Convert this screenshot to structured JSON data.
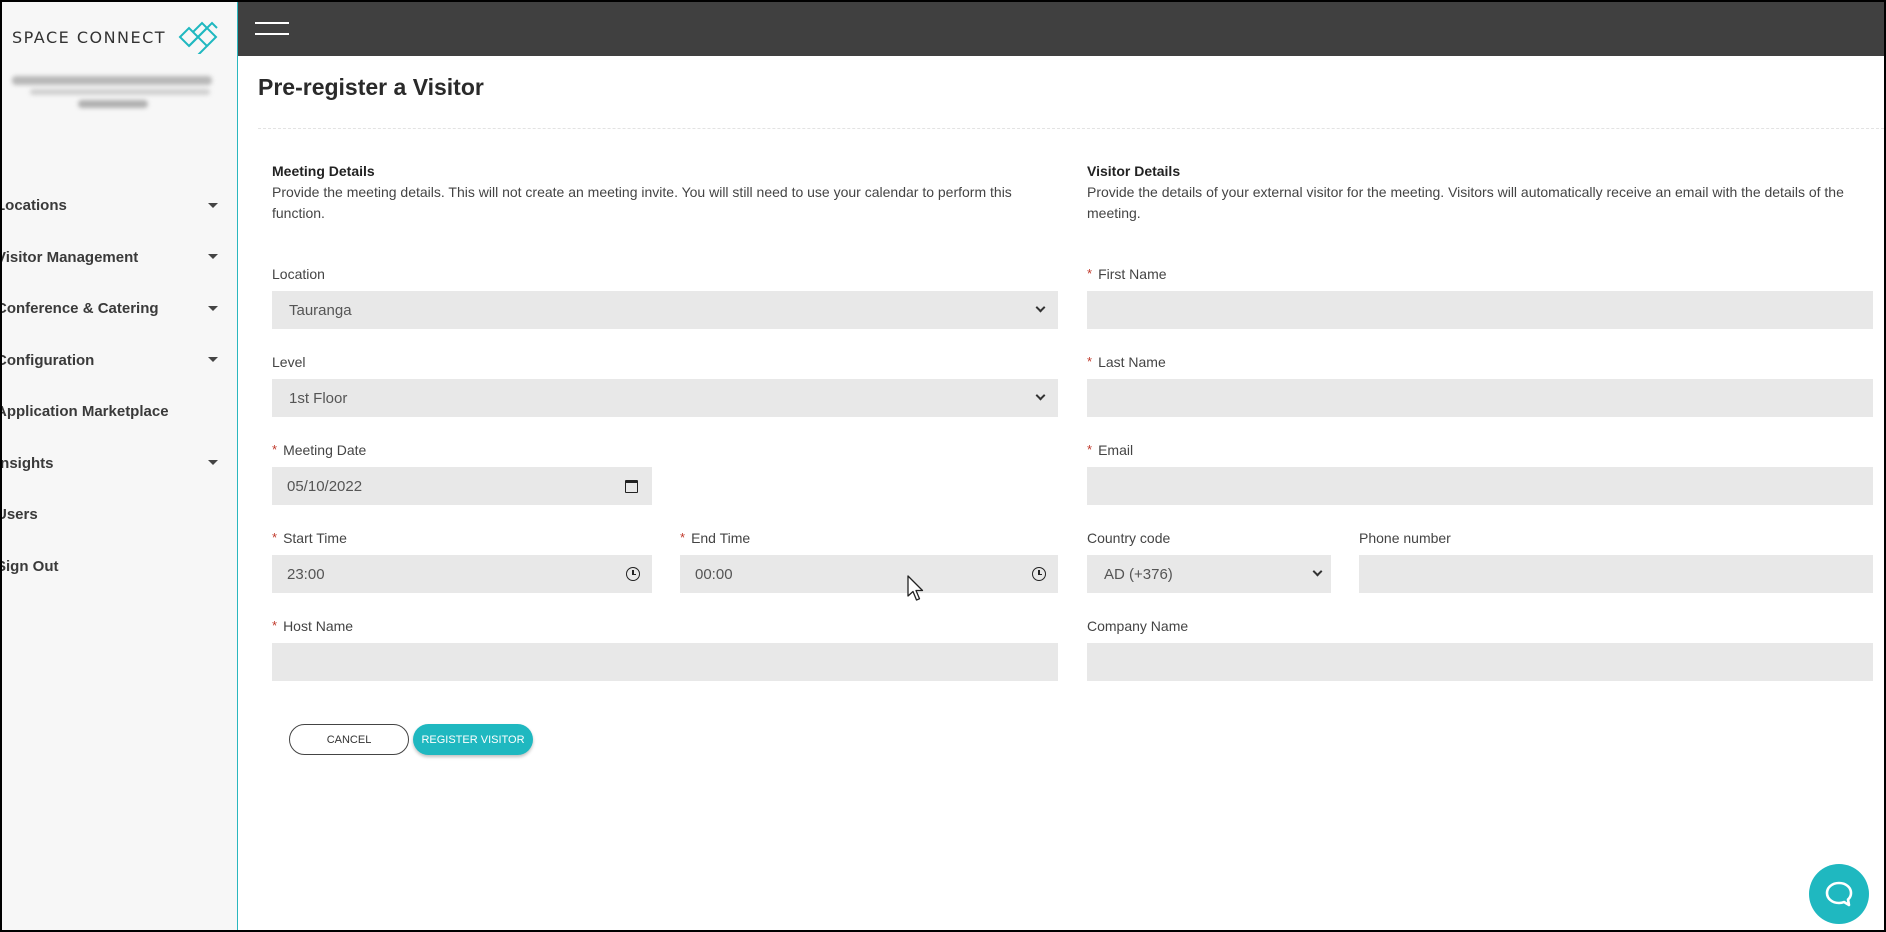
{
  "brand": {
    "logo_text": "SPACE CONNECT",
    "accent": "#1fb8c0"
  },
  "sidebar": {
    "items": [
      {
        "label": "Locations",
        "has_caret": true
      },
      {
        "label": "Visitor Management",
        "has_caret": true
      },
      {
        "label": "Conference & Catering",
        "has_caret": true
      },
      {
        "label": "Configuration",
        "has_caret": true
      },
      {
        "label": "Application Marketplace",
        "has_caret": false
      },
      {
        "label": "Insights",
        "has_caret": true
      },
      {
        "label": "Users",
        "has_caret": false
      },
      {
        "label": "Sign Out",
        "has_caret": false
      }
    ]
  },
  "page": {
    "title": "Pre-register a Visitor"
  },
  "meeting": {
    "heading": "Meeting Details",
    "description": "Provide the meeting details. This will not create an meeting invite. You will still need to use your calendar to perform this function.",
    "location": {
      "label": "Location",
      "value": "Tauranga"
    },
    "level": {
      "label": "Level",
      "value": "1st Floor"
    },
    "date": {
      "label": "Meeting Date",
      "value": "05/10/2022"
    },
    "start": {
      "label": "Start Time",
      "value": "23:00"
    },
    "end": {
      "label": "End Time",
      "value": "00:00"
    },
    "host": {
      "label": "Host Name",
      "value": ""
    }
  },
  "visitor": {
    "heading": "Visitor Details",
    "description": "Provide the details of your external visitor for the meeting. Visitors will automatically receive an email with the details of the meeting.",
    "first_name": {
      "label": "First Name",
      "value": ""
    },
    "last_name": {
      "label": "Last Name",
      "value": ""
    },
    "email": {
      "label": "Email",
      "value": ""
    },
    "country_code": {
      "label": "Country code",
      "value": "AD (+376)"
    },
    "phone": {
      "label": "Phone number",
      "value": ""
    },
    "company": {
      "label": "Company Name",
      "value": ""
    }
  },
  "actions": {
    "cancel": "CANCEL",
    "register": "REGISTER VISITOR"
  }
}
